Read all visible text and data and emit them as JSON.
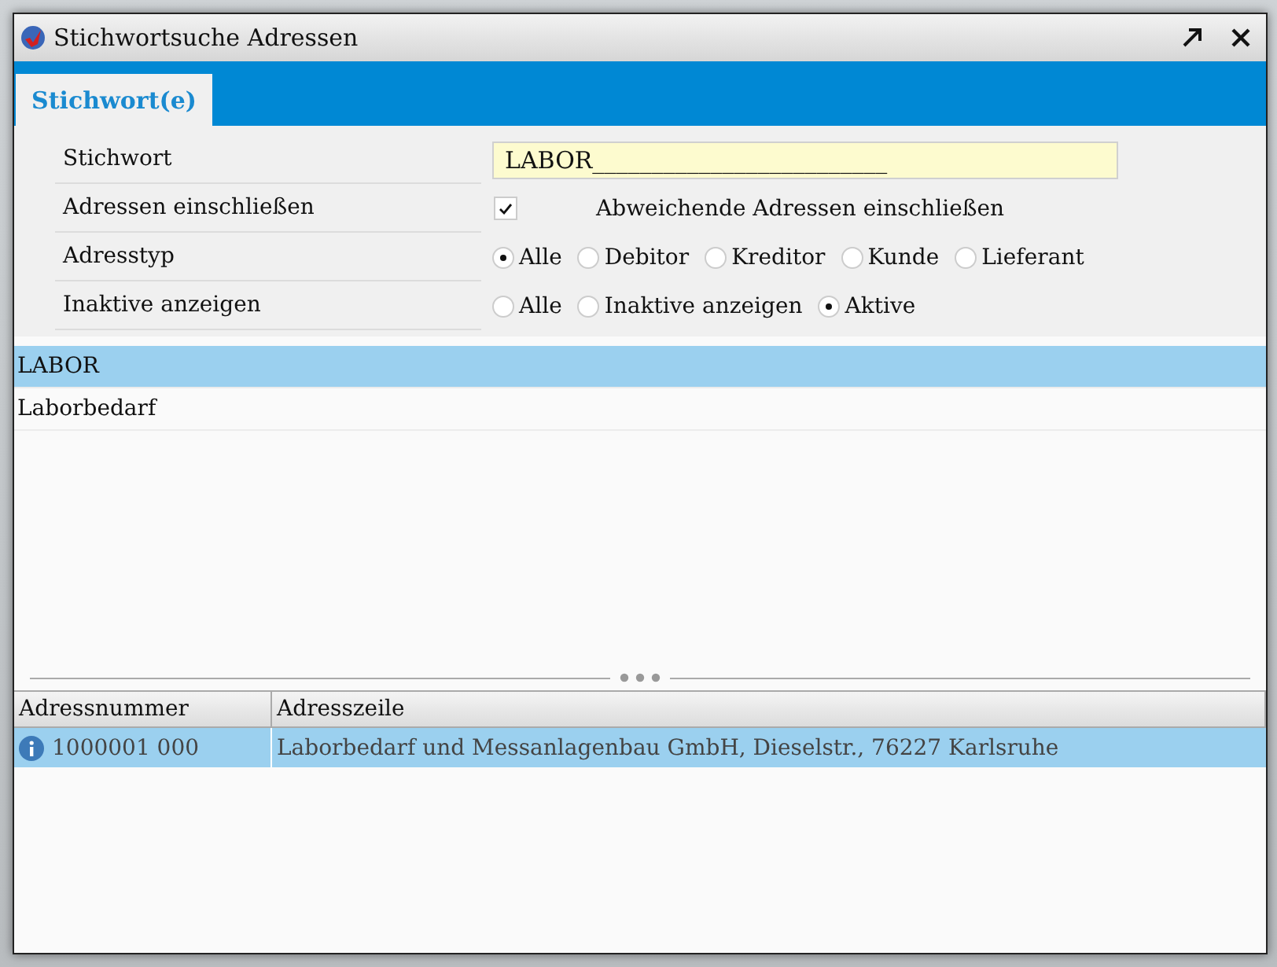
{
  "window": {
    "title": "Stichwortsuche Adressen"
  },
  "tabs": [
    {
      "label": "Stichwort(e)",
      "selected": true
    }
  ],
  "form": {
    "rows": [
      {
        "kind": "text",
        "label": "Stichwort",
        "value": "LABOR_________________________"
      },
      {
        "kind": "checkbox",
        "label": "Adressen einschließen",
        "checked": true,
        "text": "Abweichende Adressen einschließen"
      },
      {
        "kind": "radio",
        "label": "Adresstyp",
        "options": [
          {
            "label": "Alle",
            "selected": true
          },
          {
            "label": "Debitor",
            "selected": false
          },
          {
            "label": "Kreditor",
            "selected": false
          },
          {
            "label": "Kunde",
            "selected": false
          },
          {
            "label": "Lieferant",
            "selected": false
          }
        ]
      },
      {
        "kind": "radio",
        "label": "Inaktive anzeigen",
        "options": [
          {
            "label": "Alle",
            "selected": false
          },
          {
            "label": "Inaktive anzeigen",
            "selected": false
          },
          {
            "label": "Aktive",
            "selected": true
          }
        ]
      }
    ]
  },
  "keywords": [
    {
      "text": "LABOR",
      "selected": true
    },
    {
      "text": "Laborbedarf",
      "selected": false
    }
  ],
  "table": {
    "columns": [
      "Adressnummer",
      "Adresszeile"
    ],
    "rows": [
      {
        "number": "1000001 000",
        "address": "Laborbedarf und Messanlagenbau GmbH, Dieselstr., 76227 Karlsruhe",
        "selected": true
      }
    ]
  }
}
